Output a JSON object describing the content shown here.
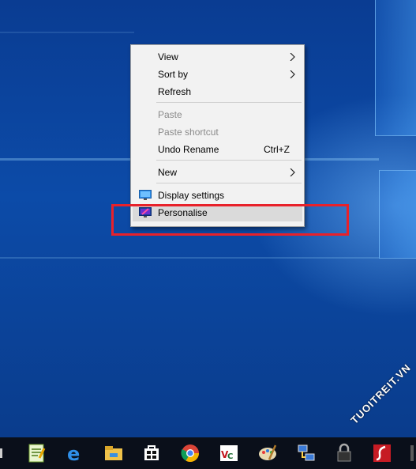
{
  "context_menu": {
    "items": [
      {
        "label": "View",
        "has_submenu": true,
        "enabled": true
      },
      {
        "label": "Sort by",
        "has_submenu": true,
        "enabled": true
      },
      {
        "label": "Refresh",
        "has_submenu": false,
        "enabled": true
      },
      {
        "label": "Paste",
        "has_submenu": false,
        "enabled": false
      },
      {
        "label": "Paste shortcut",
        "has_submenu": false,
        "enabled": false
      },
      {
        "label": "Undo Rename",
        "shortcut": "Ctrl+Z",
        "has_submenu": false,
        "enabled": true
      },
      {
        "label": "New",
        "has_submenu": true,
        "enabled": true
      },
      {
        "label": "Display settings",
        "icon": "display-settings-icon",
        "enabled": true
      },
      {
        "label": "Personalise",
        "icon": "personalise-icon",
        "enabled": true,
        "hovered": true
      }
    ]
  },
  "highlight": {
    "color": "#e8212a",
    "target": "Personalise"
  },
  "taskbar": {
    "icons": [
      "notepad-plus-icon",
      "edge-icon",
      "file-explorer-icon",
      "store-icon",
      "chrome-icon",
      "vnc-icon",
      "paint-icon",
      "network-icon",
      "lock-icon",
      "flash-icon"
    ]
  },
  "watermark": {
    "text": "TUOITREIT.VN"
  }
}
